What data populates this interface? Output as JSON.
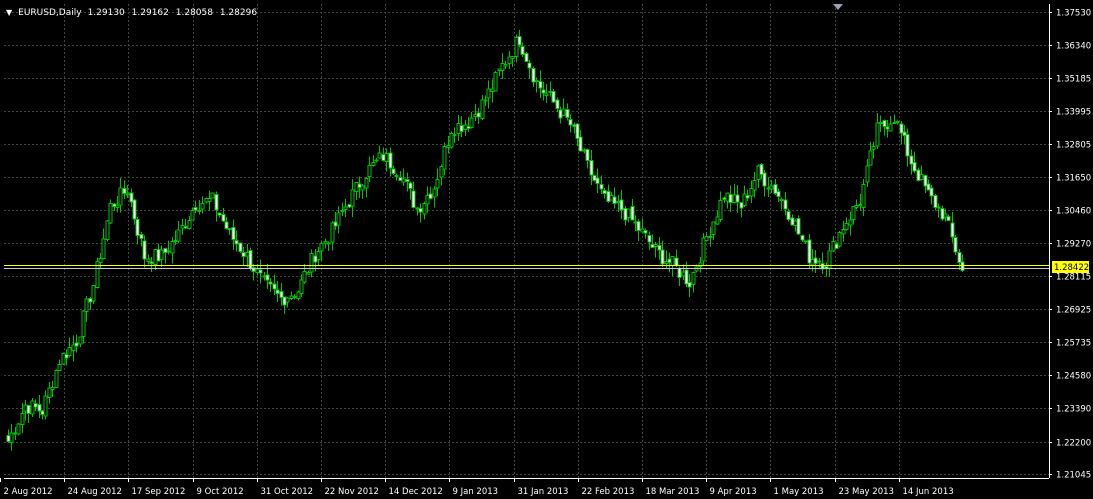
{
  "header": {
    "symbol": "EURUSD,Daily",
    "open": "1.29130",
    "high": "1.29162",
    "low": "1.28058",
    "close": "1.28296"
  },
  "price_tag": {
    "label": "1.28422",
    "color": "#ffff00"
  },
  "colors": {
    "background": "#000000",
    "grid": "#3c4a3c",
    "candle_outline": "#00c300",
    "bull_body": "#000000",
    "bear_body": "#ffffff",
    "price_line": "#c8c8c8",
    "axis_text": "#ffffff"
  },
  "chart_data": {
    "type": "candlestick",
    "symbol": "EURUSD",
    "timeframe": "Daily",
    "ylim": [
      1.2104,
      1.3753
    ],
    "y_ticks": [
      "1.37530",
      "1.36340",
      "1.35185",
      "1.33995",
      "1.32805",
      "1.31650",
      "1.30460",
      "1.29270",
      "1.28115",
      "1.26925",
      "1.25735",
      "1.24580",
      "1.23390",
      "1.22200",
      "1.21045"
    ],
    "x_ticks": [
      "2 Aug 2012",
      "24 Aug 2012",
      "17 Sep 2012",
      "9 Oct 2012",
      "31 Oct 2012",
      "22 Nov 2012",
      "14 Dec 2012",
      "9 Jan 2013",
      "31 Jan 2013",
      "22 Feb 2013",
      "18 Mar 2013",
      "9 Apr 2013",
      "1 May 2013",
      "23 May 2013",
      "14 Jun 2013"
    ],
    "grid": true,
    "current_price": 1.28422,
    "close_path": [
      [
        "2 Aug 2012",
        1.222
      ],
      [
        "9 Aug 2012",
        1.235
      ],
      [
        "16 Aug 2012",
        1.233
      ],
      [
        "24 Aug 2012",
        1.251
      ],
      [
        "31 Aug 2012",
        1.258
      ],
      [
        "10 Sep 2012",
        1.278
      ],
      [
        "14 Sep 2012",
        1.306
      ],
      [
        "17 Sep 2012",
        1.312
      ],
      [
        "24 Sep 2012",
        1.288
      ],
      [
        "1 Oct 2012",
        1.288
      ],
      [
        "9 Oct 2012",
        1.296
      ],
      [
        "12 Oct 2012",
        1.307
      ],
      [
        "17 Oct 2012",
        1.308
      ],
      [
        "24 Oct 2012",
        1.296
      ],
      [
        "31 Oct 2012",
        1.288
      ],
      [
        "6 Nov 2012",
        1.278
      ],
      [
        "13 Nov 2012",
        1.273
      ],
      [
        "16 Nov 2012",
        1.276
      ],
      [
        "22 Nov 2012",
        1.289
      ],
      [
        "29 Nov 2012",
        1.297
      ],
      [
        "6 Dec 2012",
        1.308
      ],
      [
        "14 Dec 2012",
        1.318
      ],
      [
        "19 Dec 2012",
        1.324
      ],
      [
        "28 Dec 2012",
        1.318
      ],
      [
        "4 Jan 2013",
        1.305
      ],
      [
        "9 Jan 2013",
        1.313
      ],
      [
        "14 Jan 2013",
        1.334
      ],
      [
        "21 Jan 2013",
        1.336
      ],
      [
        "28 Jan 2013",
        1.344
      ],
      [
        "31 Jan 2013",
        1.356
      ],
      [
        "1 Feb 2013",
        1.366
      ],
      [
        "6 Feb 2013",
        1.35
      ],
      [
        "12 Feb 2013",
        1.343
      ],
      [
        "18 Feb 2013",
        1.335
      ],
      [
        "22 Feb 2013",
        1.32
      ],
      [
        "27 Feb 2013",
        1.308
      ],
      [
        "5 Mar 2013",
        1.305
      ],
      [
        "12 Mar 2013",
        1.298
      ],
      [
        "18 Mar 2013",
        1.29
      ],
      [
        "25 Mar 2013",
        1.285
      ],
      [
        "2 Apr 2013",
        1.279
      ],
      [
        "9 Apr 2013",
        1.295
      ],
      [
        "15 Apr 2013",
        1.31
      ],
      [
        "23 Apr 2013",
        1.306
      ],
      [
        "1 May 2013",
        1.318
      ],
      [
        "8 May 2013",
        1.312
      ],
      [
        "14 May 2013",
        1.302
      ],
      [
        "23 May 2013",
        1.288
      ],
      [
        "28 May 2013",
        1.286
      ],
      [
        "3 Jun 2013",
        1.299
      ],
      [
        "10 Jun 2013",
        1.308
      ],
      [
        "14 Jun 2013",
        1.333
      ],
      [
        "18 Jun 2013",
        1.338
      ],
      [
        "20 Jun 2013",
        1.322
      ],
      [
        "24 Jun 2013",
        1.31
      ],
      [
        "28 Jun 2013",
        1.302
      ],
      [
        "5 Jul 2013",
        1.283
      ]
    ]
  }
}
